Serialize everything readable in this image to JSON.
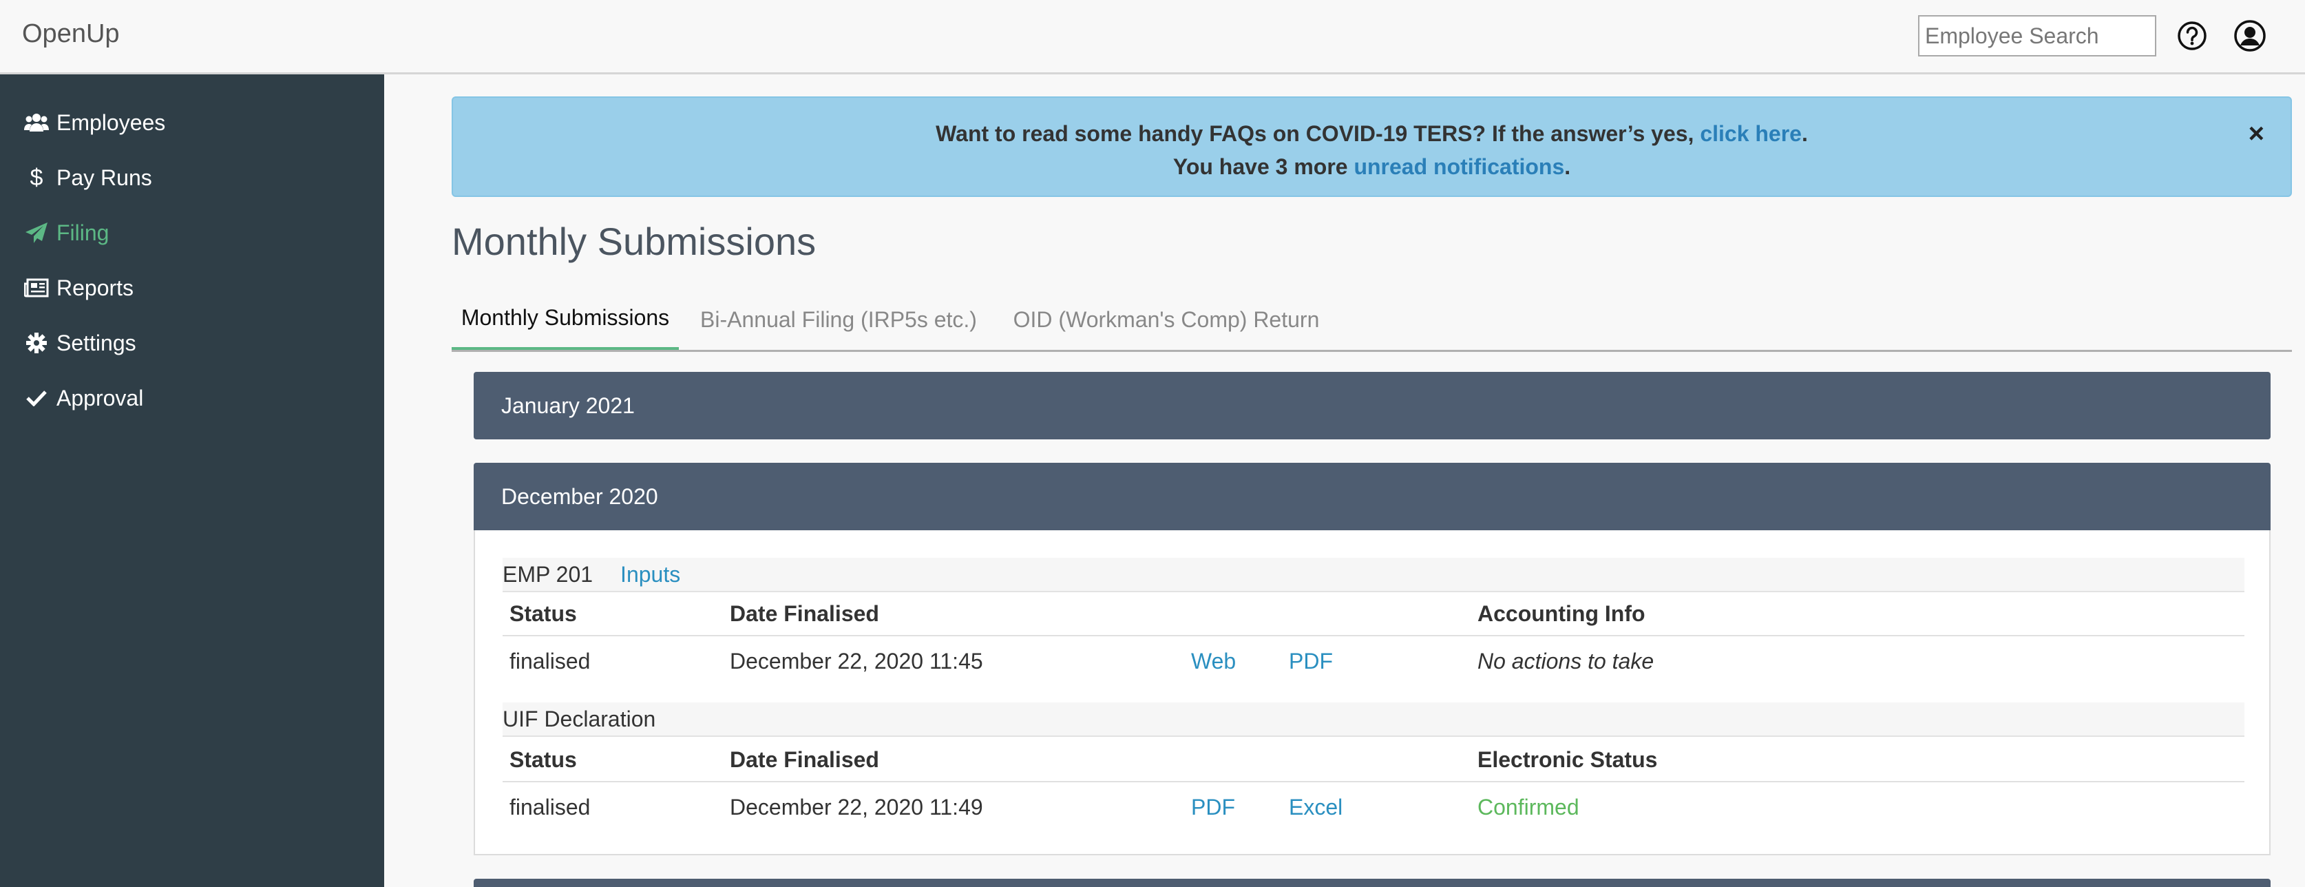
{
  "app": {
    "brand": "OpenUp",
    "search_placeholder": "Employee Search",
    "help_icon": "help-circle-icon",
    "user_icon": "user-circle-icon"
  },
  "sidebar": {
    "items": [
      {
        "label": "Employees",
        "icon": "users-icon"
      },
      {
        "label": "Pay Runs",
        "icon": "dollar-icon"
      },
      {
        "label": "Filing",
        "icon": "paper-plane-icon",
        "active": true
      },
      {
        "label": "Reports",
        "icon": "newspaper-icon"
      },
      {
        "label": "Settings",
        "icon": "gear-icon"
      },
      {
        "label": "Approval",
        "icon": "check-icon"
      }
    ],
    "active_color": "#5cb885"
  },
  "alert": {
    "line1_text": "Want to read some handy FAQs on COVID-19 TERS? If the answer’s yes, ",
    "line1_link": "click here",
    "line1_end": ".",
    "line2_text": "You have 3 more ",
    "line2_link": "unread notifications",
    "line2_end": ".",
    "close_label": "×"
  },
  "page": {
    "title": "Monthly Submissions",
    "tabs": [
      {
        "label": "Monthly Submissions",
        "active": true
      },
      {
        "label": "Bi-Annual Filing (IRP5s etc.)"
      },
      {
        "label": "OID (Workman's Comp) Return"
      }
    ]
  },
  "periods": [
    {
      "label": "January 2021"
    },
    {
      "label": "December 2020",
      "sections": [
        {
          "name": "EMP 201",
          "link": "Inputs",
          "headers": [
            "Status",
            "Date Finalised",
            "Accounting Info"
          ],
          "row": {
            "status": "finalised",
            "date": "December 22, 2020 11:45",
            "link1": "Web",
            "link2": "PDF",
            "info": "No actions to take"
          }
        },
        {
          "name": "UIF Declaration",
          "headers": [
            "Status",
            "Date Finalised",
            "Electronic Status"
          ],
          "row": {
            "status": "finalised",
            "date": "December 22, 2020 11:49",
            "link1": "PDF",
            "link2": "Excel",
            "info": "Confirmed"
          }
        }
      ]
    }
  ],
  "colors": {
    "sidebar_bg": "#2f3e47",
    "alert_bg": "#9acfea",
    "period_header_bg": "#4e5d71",
    "link": "#2a8fc0",
    "confirmed": "#5cb85c"
  }
}
